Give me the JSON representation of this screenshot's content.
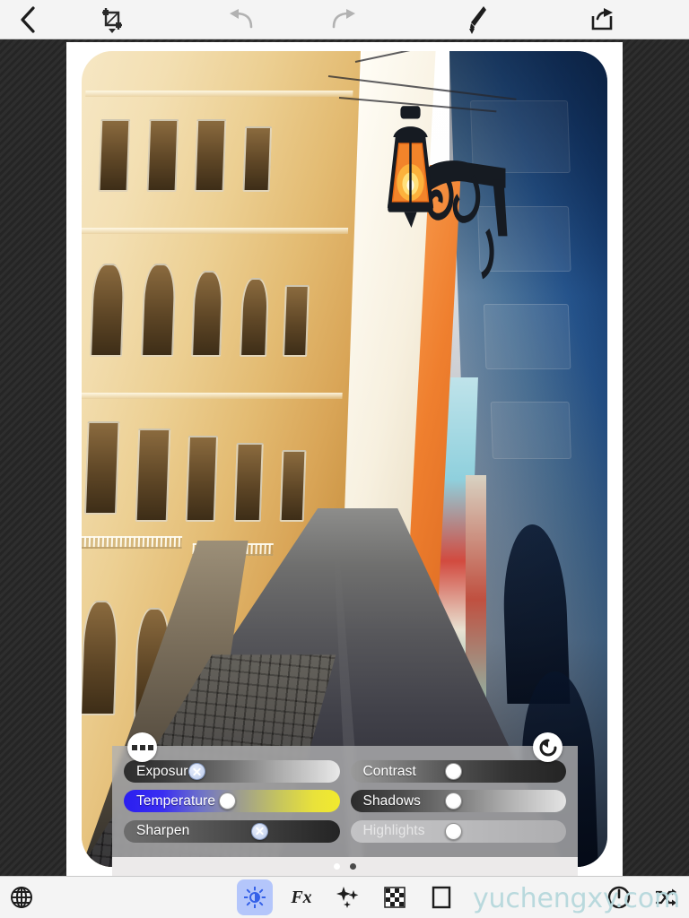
{
  "app": {
    "background_color": "#2b2b2b",
    "accent_color": "#b4c6fb",
    "watermark": "yuchengxy.com"
  },
  "top_toolbar": {
    "items": [
      {
        "name": "back",
        "icon": "chevron-left-icon",
        "enabled": true
      },
      {
        "name": "crop",
        "icon": "crop-straighten-icon",
        "enabled": true
      },
      {
        "name": "undo",
        "icon": "undo-arrow-icon",
        "enabled": false
      },
      {
        "name": "redo",
        "icon": "redo-arrow-icon",
        "enabled": false
      },
      {
        "name": "brush",
        "icon": "paint-brush-icon",
        "enabled": true
      },
      {
        "name": "share",
        "icon": "share-export-icon",
        "enabled": true
      }
    ]
  },
  "canvas": {
    "photo_alt": "Narrow colorful old-town street with a lit hanging lantern",
    "corner_radius": "34px"
  },
  "adjust_panel": {
    "more_button_icon": "three-squares-icon",
    "reset_button_icon": "reset-rotate-icon",
    "sliders": [
      {
        "label": "Exposure",
        "value": 34,
        "knob": "marked",
        "disabled": false,
        "gradient": "dark-to-light"
      },
      {
        "label": "Contrast",
        "value": 48,
        "knob": "plain",
        "disabled": false,
        "gradient": "light-to-dark"
      },
      {
        "label": "Temperature",
        "value": 48,
        "knob": "plain",
        "disabled": false,
        "gradient": "blue-to-yellow"
      },
      {
        "label": "Shadows",
        "value": 48,
        "knob": "plain",
        "disabled": false,
        "gradient": "dark-to-light"
      },
      {
        "label": "Sharpen",
        "value": 63,
        "knob": "marked",
        "disabled": false,
        "gradient": "light-to-dark"
      },
      {
        "label": "Highlights",
        "value": 48,
        "knob": "plain",
        "disabled": true,
        "gradient": "flat-grey"
      }
    ],
    "pages": {
      "count": 2,
      "active_index": 1
    }
  },
  "bottom_toolbar": {
    "left": [
      {
        "name": "globe",
        "icon": "globe-icon"
      }
    ],
    "tools": [
      {
        "name": "adjust",
        "icon": "brightness-sun-icon",
        "label": "",
        "selected": true
      },
      {
        "name": "effects",
        "icon": "fx-icon",
        "label": "Fx",
        "selected": false
      },
      {
        "name": "enhance",
        "icon": "sparkles-icon",
        "label": "",
        "selected": false
      },
      {
        "name": "texture",
        "icon": "checkerboard-icon",
        "label": "",
        "selected": false
      },
      {
        "name": "frames",
        "icon": "frame-square-icon",
        "label": "",
        "selected": false
      }
    ],
    "right": [
      {
        "name": "power",
        "icon": "power-circle-icon"
      },
      {
        "name": "shuffle",
        "icon": "shuffle-icon"
      }
    ]
  }
}
